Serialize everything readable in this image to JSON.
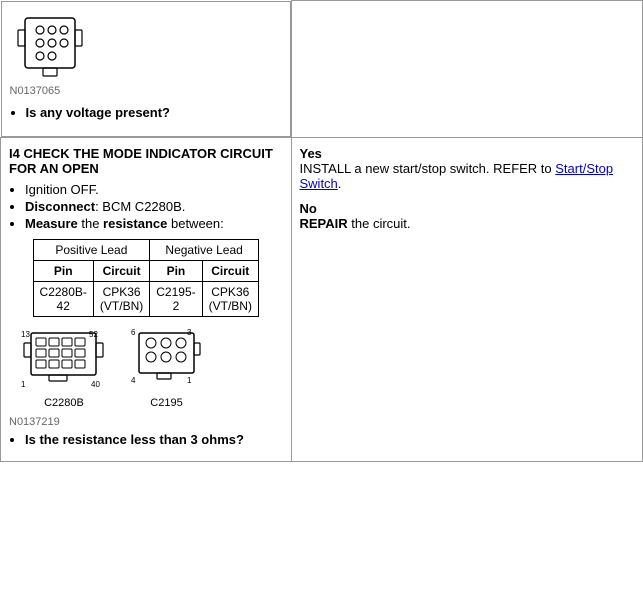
{
  "top_section": {
    "fig_number": "N0137065",
    "question": "Is any voltage present?"
  },
  "i4_section": {
    "title": "I4 CHECK THE MODE INDICATOR CIRCUIT FOR AN OPEN",
    "steps": [
      "Ignition OFF.",
      "Disconnect: BCM C2280B.",
      "Measure the resistance between:"
    ],
    "bold_words": {
      "disconnect": "Disconnect",
      "measure": "Measure",
      "resistance": "resistance"
    },
    "table": {
      "group_headers": [
        "Positive Lead",
        "Negative Lead"
      ],
      "col_headers": [
        "Pin",
        "Circuit",
        "Pin",
        "Circuit"
      ],
      "rows": [
        [
          "C2280B-42",
          "CPK36 (VT/BN)",
          "C2195-2",
          "CPK36 (VT/BN)"
        ]
      ]
    },
    "fig_number": "N0137219",
    "question2": "Is the resistance less than 3 ohms?"
  },
  "right_section": {
    "yes_label": "Yes",
    "yes_text_before": "INSTALL a new start/stop switch. REFER to ",
    "yes_link": "Start/Stop Switch",
    "yes_text_after": ".",
    "no_label": "No",
    "no_text": "REPAIR the circuit."
  },
  "connectors": {
    "c2280b": {
      "label": "C2280B",
      "pin_13": "13",
      "pin_52": "52",
      "pin_1": "1",
      "pin_40": "40"
    },
    "c2195": {
      "label": "C2195",
      "pin_6": "6",
      "pin_3": "3",
      "pin_4": "4",
      "pin_1": "1"
    }
  }
}
